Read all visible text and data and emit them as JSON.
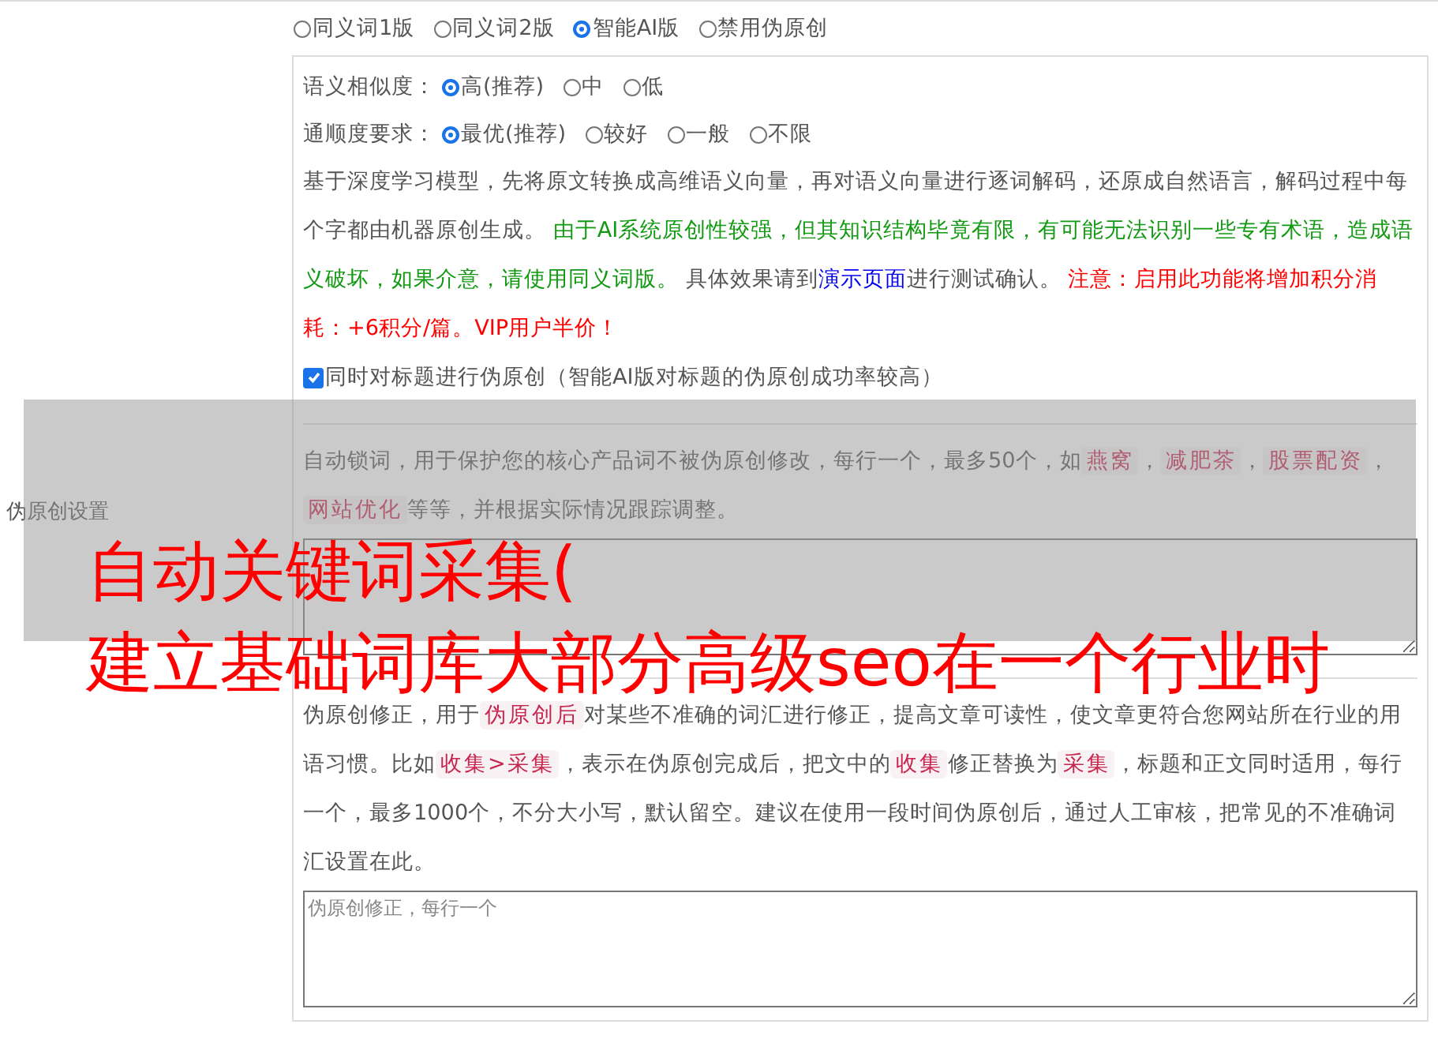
{
  "section_label": "伪原创设置",
  "modes": [
    {
      "label": "同义词1版",
      "selected": false
    },
    {
      "label": "同义词2版",
      "selected": false
    },
    {
      "label": "智能AI版",
      "selected": true
    },
    {
      "label": "禁用伪原创",
      "selected": false
    }
  ],
  "settings": [
    {
      "label": "语义相似度：",
      "options": [
        {
          "label": "高(推荐)",
          "selected": true
        },
        {
          "label": "中",
          "selected": false
        },
        {
          "label": "低",
          "selected": false
        }
      ]
    },
    {
      "label": "通顺度要求：",
      "options": [
        {
          "label": "最优(推荐)",
          "selected": true
        },
        {
          "label": "较好",
          "selected": false
        },
        {
          "label": "一般",
          "selected": false
        },
        {
          "label": "不限",
          "selected": false
        }
      ]
    }
  ],
  "ai_description": [
    {
      "kind": "plain",
      "text": "基于深度学习模型，先将原文转换成高维语义向量，再对语义向量进行逐词解码，还原成自然语言，解码过程中每个字都由机器原创生成。 "
    },
    {
      "kind": "notice",
      "text": "由于AI系统原创性较强，但其知识结构毕竟有限，有可能无法识别一些专有术语，造成语义破坏，如果介意，请使用同义词版。"
    },
    {
      "kind": "plain",
      "text": " 具体效果请到"
    },
    {
      "kind": "link",
      "text": "演示页面"
    },
    {
      "kind": "plain",
      "text": "进行测试确认。 "
    },
    {
      "kind": "alert",
      "text": "注意：启用此功能将增加积分消耗：+6积分/篇。VIP用户半价！"
    }
  ],
  "title_option": {
    "label": "同时对标题进行伪原创（智能AI版对标题的伪原创成功率较高）",
    "checked": true
  },
  "lock_words": {
    "description": [
      {
        "kind": "plain",
        "text": "自动锁词，用于保护您的核心产品词不被伪原创修改，每行一个，最多50个，如"
      },
      {
        "kind": "code",
        "text": "燕窝"
      },
      {
        "kind": "plain",
        "text": "，"
      },
      {
        "kind": "code",
        "text": "减肥茶"
      },
      {
        "kind": "plain",
        "text": "，"
      },
      {
        "kind": "code",
        "text": "股票配资"
      },
      {
        "kind": "plain",
        "text": "，"
      },
      {
        "kind": "code",
        "text": "网站优化"
      },
      {
        "kind": "plain",
        "text": "等等，并根据实际情况跟踪调整。"
      }
    ]
  },
  "corrections": {
    "description": [
      {
        "kind": "plain",
        "text": "伪原创修正，用于"
      },
      {
        "kind": "code",
        "text": "伪原创后"
      },
      {
        "kind": "plain",
        "text": "对某些不准确的词汇进行修正，提高文章可读性，使文章更符合您网站所在行业的用语习惯。比如"
      },
      {
        "kind": "code",
        "text": "收集>采集"
      },
      {
        "kind": "plain",
        "text": "，表示在伪原创完成后，把文中的"
      },
      {
        "kind": "code",
        "text": "收集"
      },
      {
        "kind": "plain",
        "text": "修正替换为"
      },
      {
        "kind": "code",
        "text": "采集"
      },
      {
        "kind": "plain",
        "text": "，标题和正文同时适用，每行一个，最多1000个，不分大小写，默认留空。建议在使用一段时间伪原创后，通过人工审核，把常见的不准确词汇设置在此。"
      }
    ],
    "placeholder": "伪原创修正，每行一个"
  },
  "overlay": {
    "lines": [
      "自动关键词采集(",
      "建立基础词库大部分高级seo在一个行业时"
    ]
  }
}
